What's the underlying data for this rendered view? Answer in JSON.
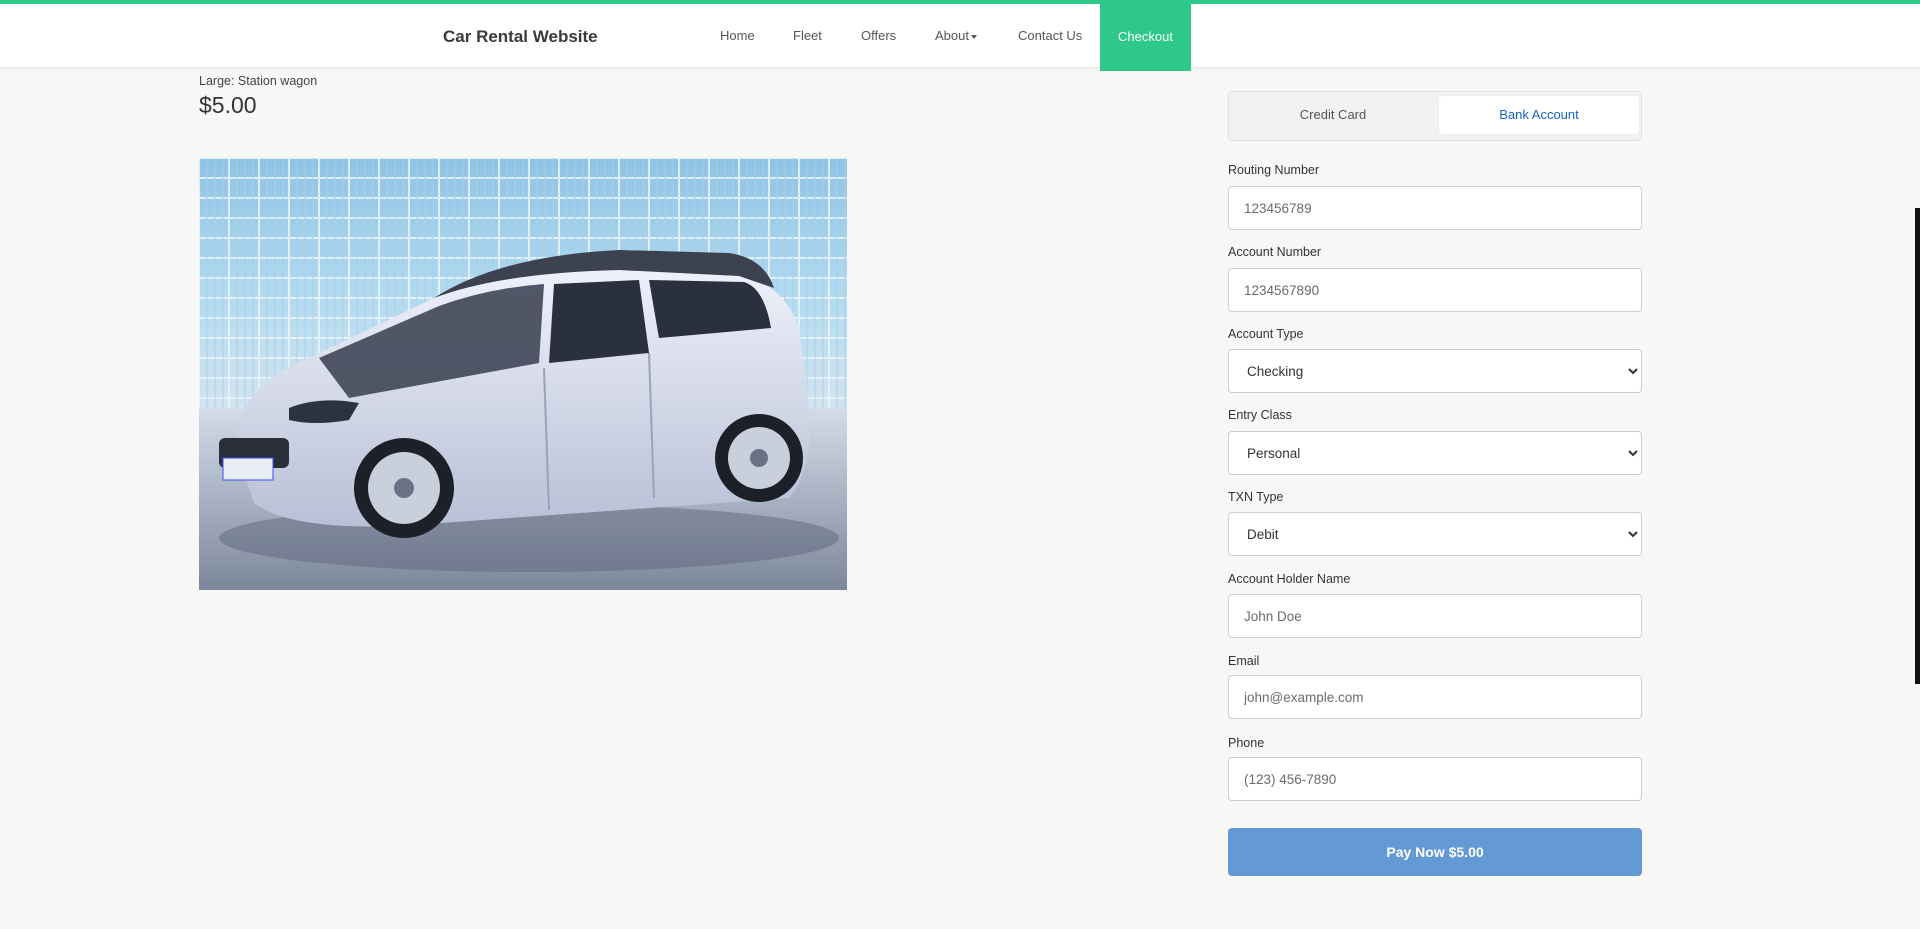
{
  "navbar": {
    "brand": "Car Rental Website",
    "items": [
      {
        "label": "Home"
      },
      {
        "label": "Fleet"
      },
      {
        "label": "Offers"
      },
      {
        "label": "About"
      },
      {
        "label": "Contact Us"
      }
    ],
    "active": {
      "label": "Checkout"
    },
    "accent_color": "#2ec98a"
  },
  "product": {
    "type": "Large: Station wagon",
    "price": "$5.00",
    "image_icon": "car-photo"
  },
  "payment": {
    "tabs": [
      {
        "label": "Credit Card",
        "active": false
      },
      {
        "label": "Bank Account",
        "active": true
      }
    ],
    "fields": {
      "routing": {
        "label": "Routing Number",
        "placeholder": "123456789",
        "value": ""
      },
      "account": {
        "label": "Account Number",
        "placeholder": "1234567890",
        "value": ""
      },
      "account_type": {
        "label": "Account Type",
        "selected": "Checking"
      },
      "entry_class": {
        "label": "Entry Class",
        "selected": "Personal"
      },
      "txn_type": {
        "label": "TXN Type",
        "selected": "Debit"
      },
      "holder": {
        "label": "Account Holder Name",
        "placeholder": "John Doe",
        "value": ""
      },
      "email": {
        "label": "Email",
        "placeholder": "john@example.com",
        "value": ""
      },
      "phone": {
        "label": "Phone",
        "placeholder": "(123) 456-7890",
        "value": ""
      }
    },
    "pay_button": "Pay Now $5.00",
    "button_color": "#6399d4"
  }
}
